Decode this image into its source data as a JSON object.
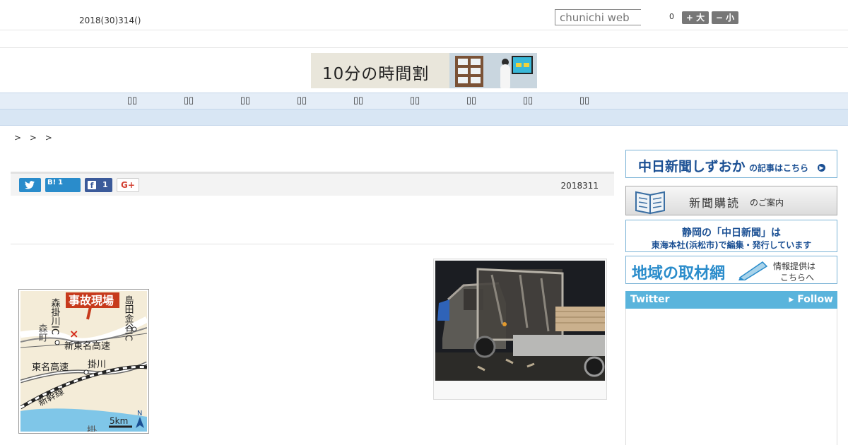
{
  "header": {
    "date": "2018(30)314()",
    "search_placeholder": "chunichi web",
    "font_count": "0",
    "font_big": "+ 大",
    "font_small": "− 小"
  },
  "banner": {
    "text": "10分の時間割"
  },
  "nav": {
    "items": [
      "",
      "",
      "",
      "",
      "",
      "",
      "",
      "",
      ""
    ]
  },
  "breadcrumb": {
    "text": "> > >"
  },
  "share": {
    "hatena_label": "B!",
    "hatena_count": "1",
    "facebook_count": "1",
    "gplus_label": "G+",
    "pub_date": "2018311"
  },
  "map": {
    "title": "事故現場",
    "shinto_mei": "新東名高速",
    "tomei": "東名高速",
    "shinkansen": "新幹線",
    "kakegawa": "掛川",
    "kakegawa_city": "掛川市",
    "mori_kakegawa_ic": "森掛川IC",
    "shimada_kanaya_ic": "島田金谷IC",
    "mori_town": "森町",
    "scale": "5km",
    "north": "N"
  },
  "sidebar": {
    "shizuoka_main": "中日新聞しずおか",
    "shizuoka_sub": "の記事はこちら",
    "subscribe_main": "新聞購読",
    "subscribe_sub": "のご案内",
    "hq_line1": "静岡の「中日新聞」は",
    "hq_line2": "東海本社(浜松市)で編集・発行しています",
    "network_main": "地域の取材網",
    "network_sub1": "情報提供は",
    "network_sub2": "こちらへ",
    "twitter_label": "Twitter",
    "twitter_follow": "▸ Follow"
  }
}
